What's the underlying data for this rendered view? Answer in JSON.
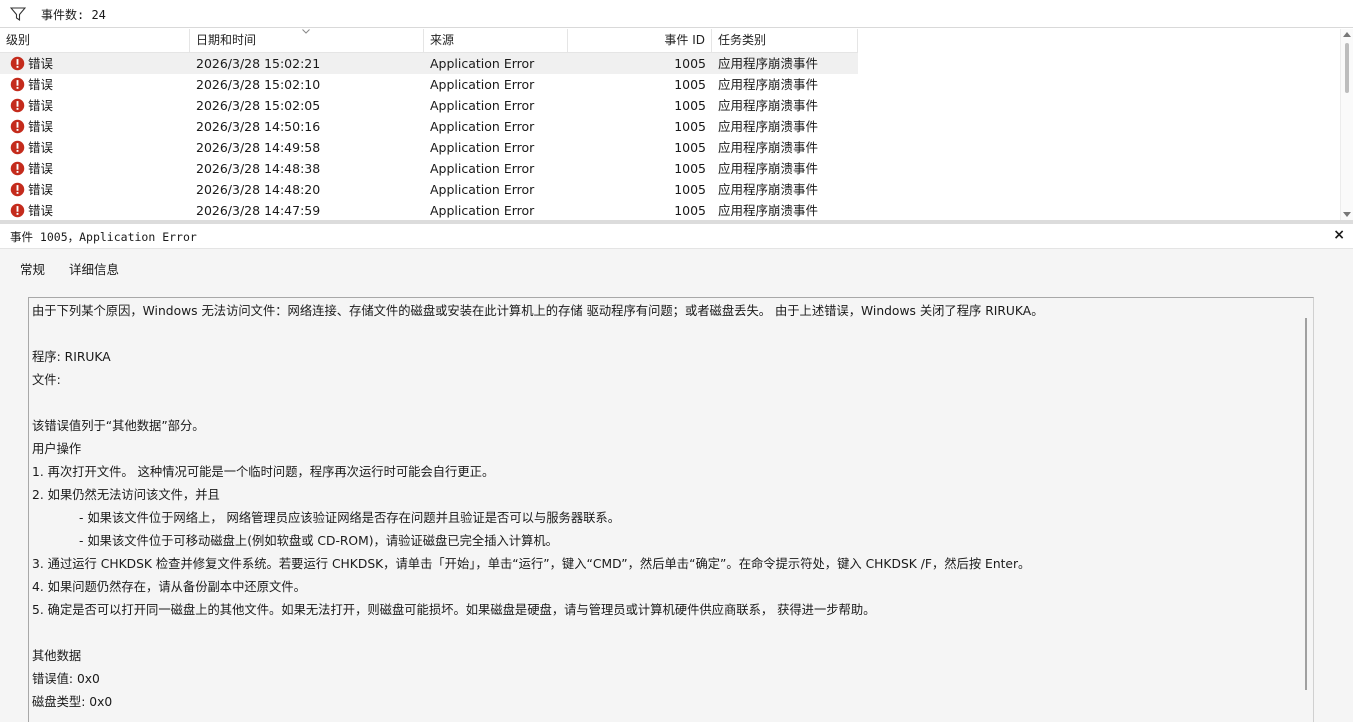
{
  "toolbar": {
    "event_count": "事件数: 24"
  },
  "grid": {
    "columns": [
      "级别",
      "日期和时间",
      "来源",
      "事件 ID",
      "任务类别"
    ],
    "rows": [
      {
        "level": "错误",
        "datetime": "2026/3/28 15:02:21",
        "source": "Application Error",
        "event_id": "1005",
        "category": "应用程序崩溃事件"
      },
      {
        "level": "错误",
        "datetime": "2026/3/28 15:02:10",
        "source": "Application Error",
        "event_id": "1005",
        "category": "应用程序崩溃事件"
      },
      {
        "level": "错误",
        "datetime": "2026/3/28 15:02:05",
        "source": "Application Error",
        "event_id": "1005",
        "category": "应用程序崩溃事件"
      },
      {
        "level": "错误",
        "datetime": "2026/3/28 14:50:16",
        "source": "Application Error",
        "event_id": "1005",
        "category": "应用程序崩溃事件"
      },
      {
        "level": "错误",
        "datetime": "2026/3/28 14:49:58",
        "source": "Application Error",
        "event_id": "1005",
        "category": "应用程序崩溃事件"
      },
      {
        "level": "错误",
        "datetime": "2026/3/28 14:48:38",
        "source": "Application Error",
        "event_id": "1005",
        "category": "应用程序崩溃事件"
      },
      {
        "level": "错误",
        "datetime": "2026/3/28 14:48:20",
        "source": "Application Error",
        "event_id": "1005",
        "category": "应用程序崩溃事件"
      },
      {
        "level": "错误",
        "datetime": "2026/3/28 14:47:59",
        "source": "Application Error",
        "event_id": "1005",
        "category": "应用程序崩溃事件"
      }
    ]
  },
  "detail": {
    "title": "事件 1005，Application Error",
    "close": "×",
    "tabs": [
      "常规",
      "详细信息"
    ],
    "lines": [
      "由于下列某个原因，Windows 无法访问文件：网络连接、存储文件的磁盘或安装在此计算机上的存储 驱动程序有问题；或者磁盘丢失。 由于上述错误，Windows 关闭了程序 RIRUKA。",
      "程序: RIRUKA",
      "文件:",
      "该错误值列于“其他数据”部分。",
      "用户操作",
      "1. 再次打开文件。 这种情况可能是一个临时问题，程序再次运行时可能会自行更正。",
      "2. 如果仍然无法访问该文件，并且",
      "- 如果该文件位于网络上， 网络管理员应该验证网络是否存在问题并且验证是否可以与服务器联系。",
      "- 如果该文件位于可移动磁盘上(例如软盘或 CD-ROM)，请验证磁盘已完全插入计算机。",
      "3. 通过运行 CHKDSK 检查并修复文件系统。若要运行 CHKDSK，请单击「开始」，单击“运行”，键入“CMD”，然后单击“确定”。在命令提示符处，键入 CHKDSK /F，然后按 Enter。",
      "4. 如果问题仍然存在，请从备份副本中还原文件。",
      "5. 确定是否可以打开同一磁盘上的其他文件。如果无法打开，则磁盘可能损坏。如果磁盘是硬盘，请与管理员或计算机硬件供应商联系， 获得进一步帮助。",
      "其他数据",
      "错误值: 0x0",
      "磁盘类型: 0x0"
    ]
  },
  "colors": {
    "error_red": "#c42b1c",
    "selected_row": "#f0f0f0"
  }
}
